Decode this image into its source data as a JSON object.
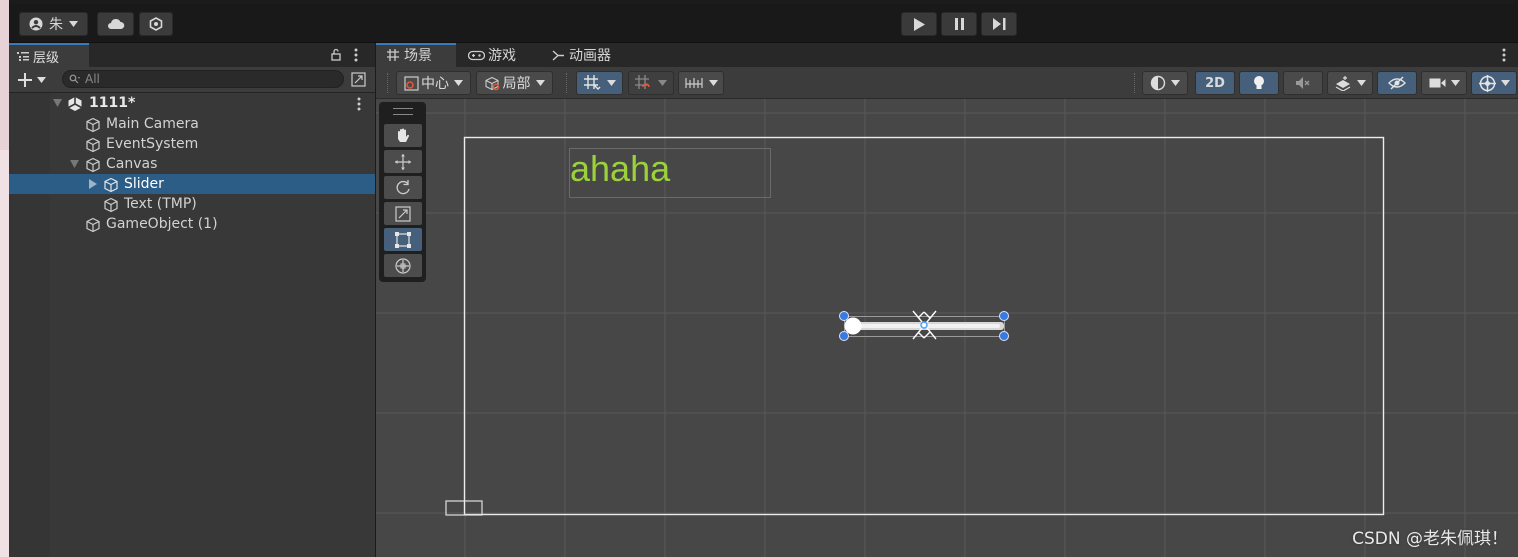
{
  "account": {
    "name": "朱",
    "icon": "user-icon"
  },
  "play_controls": [
    "play-icon",
    "pause-icon",
    "step-icon"
  ],
  "hierarchy": {
    "tab_label": "层级",
    "search_placeholder": "All",
    "scene_name": "1111*",
    "items": [
      {
        "label": "Main Camera"
      },
      {
        "label": "EventSystem"
      },
      {
        "label": "Canvas"
      },
      {
        "label": "Slider"
      },
      {
        "label": "Text (TMP)"
      },
      {
        "label": "GameObject (1)"
      }
    ]
  },
  "scene_tabs": [
    {
      "label": "场景"
    },
    {
      "label": "游戏"
    },
    {
      "label": "动画器"
    }
  ],
  "scene_toolbar": {
    "pivot_label": "中心",
    "space_label": "局部",
    "mode_2d_label": "2D"
  },
  "scene_view": {
    "text_object": "ahaha",
    "text_color": "#9bd13a",
    "selection_color": "#3a79bb"
  },
  "watermark": "CSDN @老朱佩琪！"
}
